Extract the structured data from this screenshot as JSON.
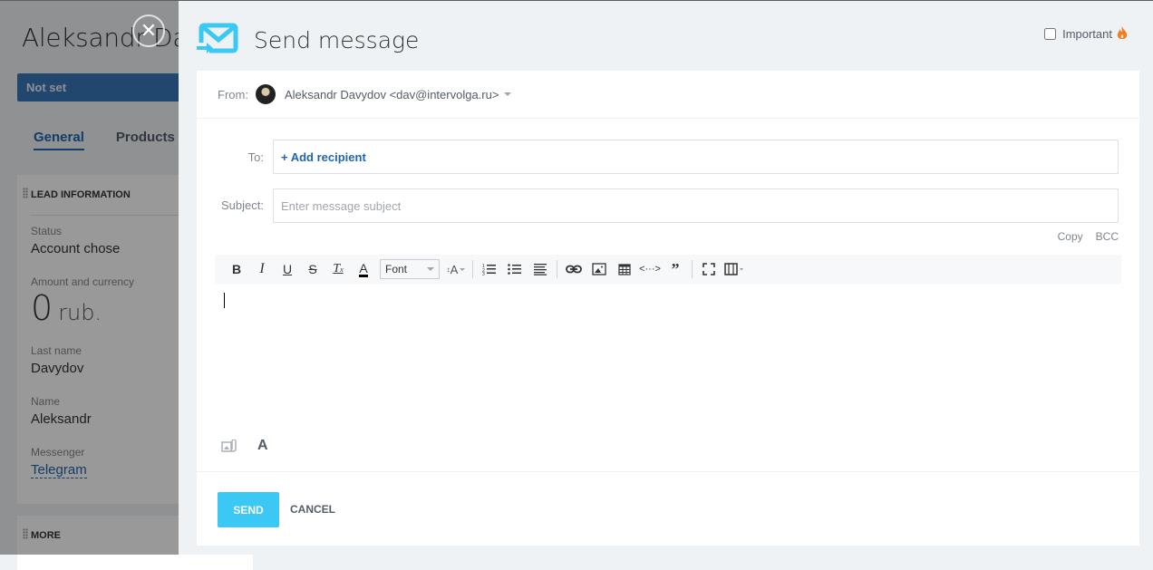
{
  "background": {
    "title": "Aleksandr Davydov",
    "stage": "Not set",
    "tabs": [
      {
        "label": "General",
        "active": true
      },
      {
        "label": "Products",
        "active": false
      }
    ],
    "lead_card": {
      "heading": "LEAD INFORMATION",
      "fields": [
        {
          "label": "Status",
          "value": "Account chose"
        },
        {
          "label": "Amount and currency",
          "amount": "0",
          "currency": "rub."
        },
        {
          "label": "Last name",
          "value": "Davydov"
        },
        {
          "label": "Name",
          "value": "Aleksandr"
        },
        {
          "label": "Messenger",
          "value": "Telegram"
        }
      ]
    },
    "more_card": {
      "heading": "MORE"
    }
  },
  "slider": {
    "close_icon": "close-icon",
    "title": "Send message",
    "title_icon": "mail-send-icon",
    "important_label": "Important",
    "important_checked": false,
    "from": {
      "label": "From:",
      "value": "Aleksandr Davydov <dav@intervolga.ru>"
    },
    "to": {
      "label": "To:",
      "add_label": "+ Add recipient"
    },
    "subject": {
      "label": "Subject:",
      "placeholder": "Enter message subject",
      "value": ""
    },
    "copy_label": "Copy",
    "bcc_label": "BCC",
    "toolbar": {
      "font_label": "Font",
      "buttons": [
        "bold",
        "italic",
        "underline",
        "strikethrough",
        "remove-format",
        "text-color",
        "font",
        "font-size",
        "ordered-list",
        "unordered-list",
        "align",
        "link",
        "image",
        "table",
        "source",
        "quote",
        "fullscreen",
        "more"
      ]
    },
    "editor_body": "",
    "send_label": "SEND",
    "cancel_label": "CANCEL",
    "colors": {
      "accent": "#3bc8f5",
      "link": "#2067b0",
      "fire": "#f57c1f"
    }
  }
}
